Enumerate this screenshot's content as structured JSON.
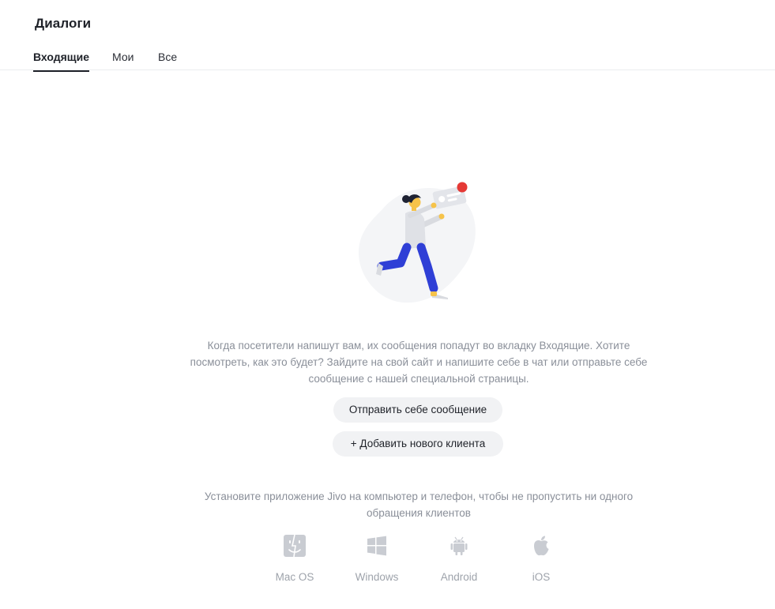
{
  "page": {
    "title": "Диалоги"
  },
  "tabs": [
    {
      "label": "Входящие",
      "active": true
    },
    {
      "label": "Мои",
      "active": false
    },
    {
      "label": "Все",
      "active": false
    }
  ],
  "empty_state": {
    "message": "Когда посетители напишут вам, их сообщения попадут во вкладку Входящие. Хотите посмотреть, как это будет? Зайдите на свой сайт и напишите себе в чат или отправьте себе сообщение с нашей специальной страницы.",
    "send_button": "Отправить себе сообщение",
    "add_client_button": "+ Добавить нового клиента"
  },
  "apps": {
    "message": "Установите приложение Jivo на компьютер и телефон, чтобы не пропустить ни одного обращения клиентов",
    "items": [
      {
        "label": "Mac OS",
        "icon": "macos-finder-icon"
      },
      {
        "label": "Windows",
        "icon": "windows-icon"
      },
      {
        "label": "Android",
        "icon": "android-icon"
      },
      {
        "label": "iOS",
        "icon": "apple-icon"
      }
    ]
  },
  "colors": {
    "accent_red": "#e53935",
    "figure_blue": "#2f3fd6",
    "text_muted": "#8a8f99",
    "button_bg": "#f1f2f4"
  }
}
